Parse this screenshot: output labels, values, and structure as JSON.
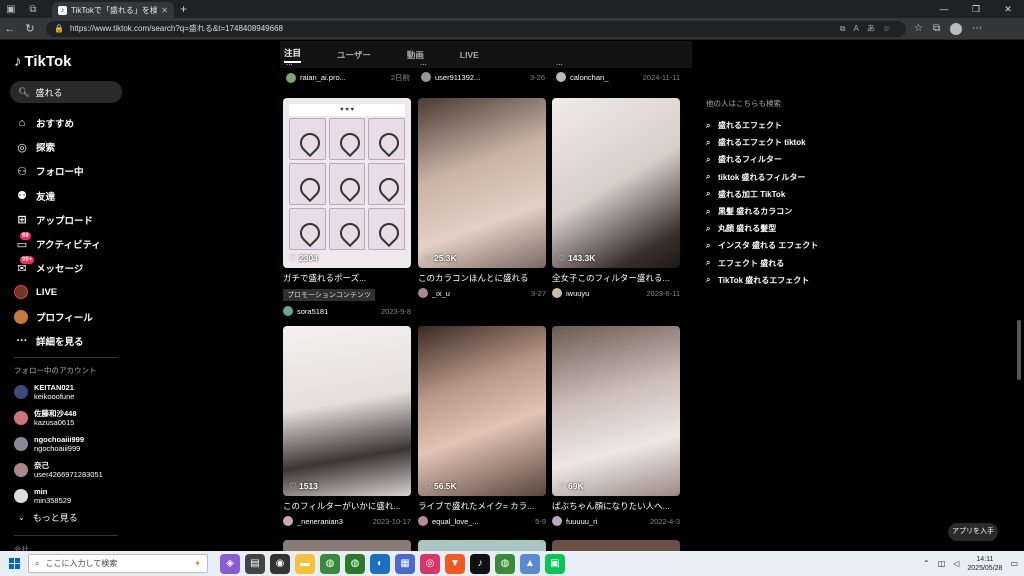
{
  "browser": {
    "tab_title": "TikTokで「盛れる」を検索 | TikTok",
    "url": "https://www.tiktok.com/search?q=盛れる&t=1748408949668"
  },
  "sidebar": {
    "logo": "TikTok",
    "search_value": "盛れる",
    "nav": [
      {
        "label": "おすすめ",
        "icon": "home-icon",
        "glyph": "⌂"
      },
      {
        "label": "探索",
        "icon": "compass-icon",
        "glyph": "◎"
      },
      {
        "label": "フォロー中",
        "icon": "following-icon",
        "glyph": "⚇"
      },
      {
        "label": "友達",
        "icon": "friends-icon",
        "glyph": "⚉"
      },
      {
        "label": "アップロード",
        "icon": "upload-icon",
        "glyph": "⊞"
      },
      {
        "label": "アクティビティ",
        "icon": "activity-icon",
        "glyph": "▭",
        "badge": "69"
      },
      {
        "label": "メッセージ",
        "icon": "message-icon",
        "glyph": "✉",
        "badge": "99+"
      },
      {
        "label": "LIVE",
        "icon": "live-icon",
        "glyph": ""
      },
      {
        "label": "プロフィール",
        "icon": "profile-icon",
        "glyph": ""
      },
      {
        "label": "詳細を見る",
        "icon": "more-icon",
        "glyph": "···"
      }
    ],
    "following_title": "フォロー中のアカウント",
    "accounts": [
      {
        "name": "KEITAN021",
        "id": "keikooofune",
        "color": "#3a4a7a"
      },
      {
        "name": "佐藤和沙448",
        "id": "kazusa0615",
        "color": "#c77"
      },
      {
        "name": "ngochoaiii999",
        "id": "ngochoaiii999",
        "color": "#889"
      },
      {
        "name": "奈己",
        "id": "user4266971283051",
        "color": "#a88"
      },
      {
        "name": "min",
        "id": "min358529",
        "color": "#ddd"
      }
    ],
    "more_label": "もっと見る",
    "company_label": "会社"
  },
  "search_tabs": [
    "注目",
    "ユーザー",
    "動画",
    "LIVE"
  ],
  "top_row": [
    {
      "caption": "...",
      "user": "raian_ai.pro...",
      "date": "2日前",
      "color": "#7a6"
    },
    {
      "caption": "...",
      "user": "user911392...",
      "date": "3-26",
      "color": "#999"
    },
    {
      "caption": "...",
      "user": "calonchan_",
      "date": "2024-11-11",
      "color": "#bbb"
    }
  ],
  "videos": [
    {
      "likes": "2304",
      "caption": "ガチで盛れるポーズ...",
      "promo": "プロモーションコンテンツ",
      "user": "sora5181",
      "date": "2023-9-8",
      "bg": "#efe8ee",
      "avatar": "#6a8"
    },
    {
      "likes": "25.3K",
      "caption": "このカラコンほんとに盛れる",
      "user": "_ix_u",
      "date": "3-27",
      "bg": "#c9b3a6",
      "avatar": "#a89"
    },
    {
      "likes": "143.3K",
      "caption": "全女子このフィルター盛れる...",
      "user": "iwuuyu",
      "date": "2023-6-11",
      "bg": "#d8cec8",
      "avatar": "#cba"
    },
    {
      "likes": "1513",
      "caption": "このフィルターがいかに盛れ...",
      "user": "_neneranian3",
      "date": "2023-10-17",
      "bg": "#e4dedd",
      "avatar": "#caa"
    },
    {
      "likes": "56.5K",
      "caption": "ライブで盛れたメイク= カラ...",
      "user": "equal_love_...",
      "date": "5-9",
      "bg": "#b99888",
      "avatar": "#b89"
    },
    {
      "likes": "69K",
      "caption": "ぱぶちゃん顔になりたい人へ...",
      "user": "fuuuuu_ri",
      "date": "2022-4-3",
      "bg": "#cbbdb6",
      "avatar": "#bab"
    }
  ],
  "related": {
    "title": "他の人はこちらも検索",
    "items": [
      "盛れるエフェクト",
      "盛れるエフェクト tiktok",
      "盛れるフィルター",
      "tiktok 盛れるフィルター",
      "盛れる加工 TikTok",
      "黒髪 盛れるカラコン",
      "丸顔 盛れる髪型",
      "インスタ 盛れる エフェクト",
      "エフェクト 盛れる",
      "TikTok 盛れるエフェクト"
    ]
  },
  "get_app": "アプリを入手",
  "taskbar": {
    "search_placeholder": "ここに入力して検索",
    "time": "14:11",
    "date": "2025/05/28"
  }
}
